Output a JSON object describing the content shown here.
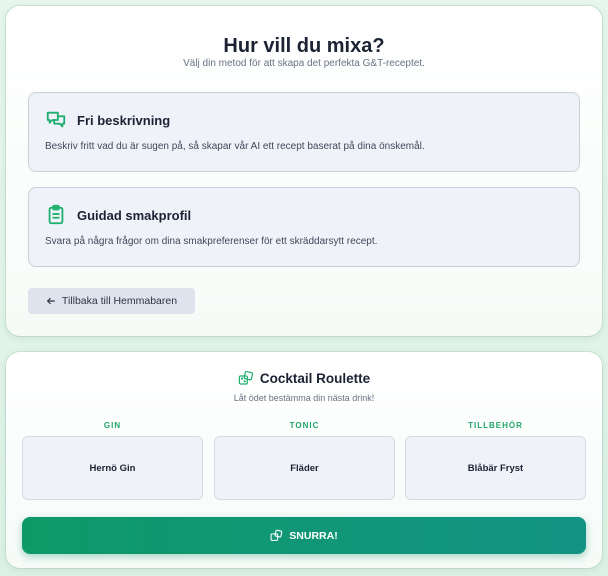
{
  "mix": {
    "title": "Hur vill du mixa?",
    "subtitle": "Välj din metod för att skapa det perfekta G&T-receptet.",
    "options": [
      {
        "icon": "chat-bubbles-icon",
        "title": "Fri beskrivning",
        "description": "Beskriv fritt vad du är sugen på, så skapar vår AI ett recept baserat på dina önskemål."
      },
      {
        "icon": "clipboard-icon",
        "title": "Guidad smakprofil",
        "description": "Svara på några frågor om dina smakpreferenser för ett skräddarsytt recept."
      }
    ],
    "back_button": {
      "icon": "arrow-left-icon",
      "label": "Tillbaka till Hemmabaren"
    }
  },
  "roulette": {
    "icon": "dice-icon",
    "title": "Cocktail Roulette",
    "subtitle": "Låt ödet bestämma din nästa drink!",
    "slots": [
      {
        "label": "GIN",
        "value": "Hernö Gin"
      },
      {
        "label": "TONIC",
        "value": "Fläder"
      },
      {
        "label": "TILLBEHÖR",
        "value": "Blåbär Fryst"
      }
    ],
    "spin_button": {
      "icon": "dice-icon",
      "label": "SNURRA!"
    }
  },
  "colors": {
    "accent": "#1fae6e",
    "button_gradient_start": "#0e9a68",
    "button_gradient_end": "#139385",
    "card_option_bg": "#eff2f9"
  }
}
